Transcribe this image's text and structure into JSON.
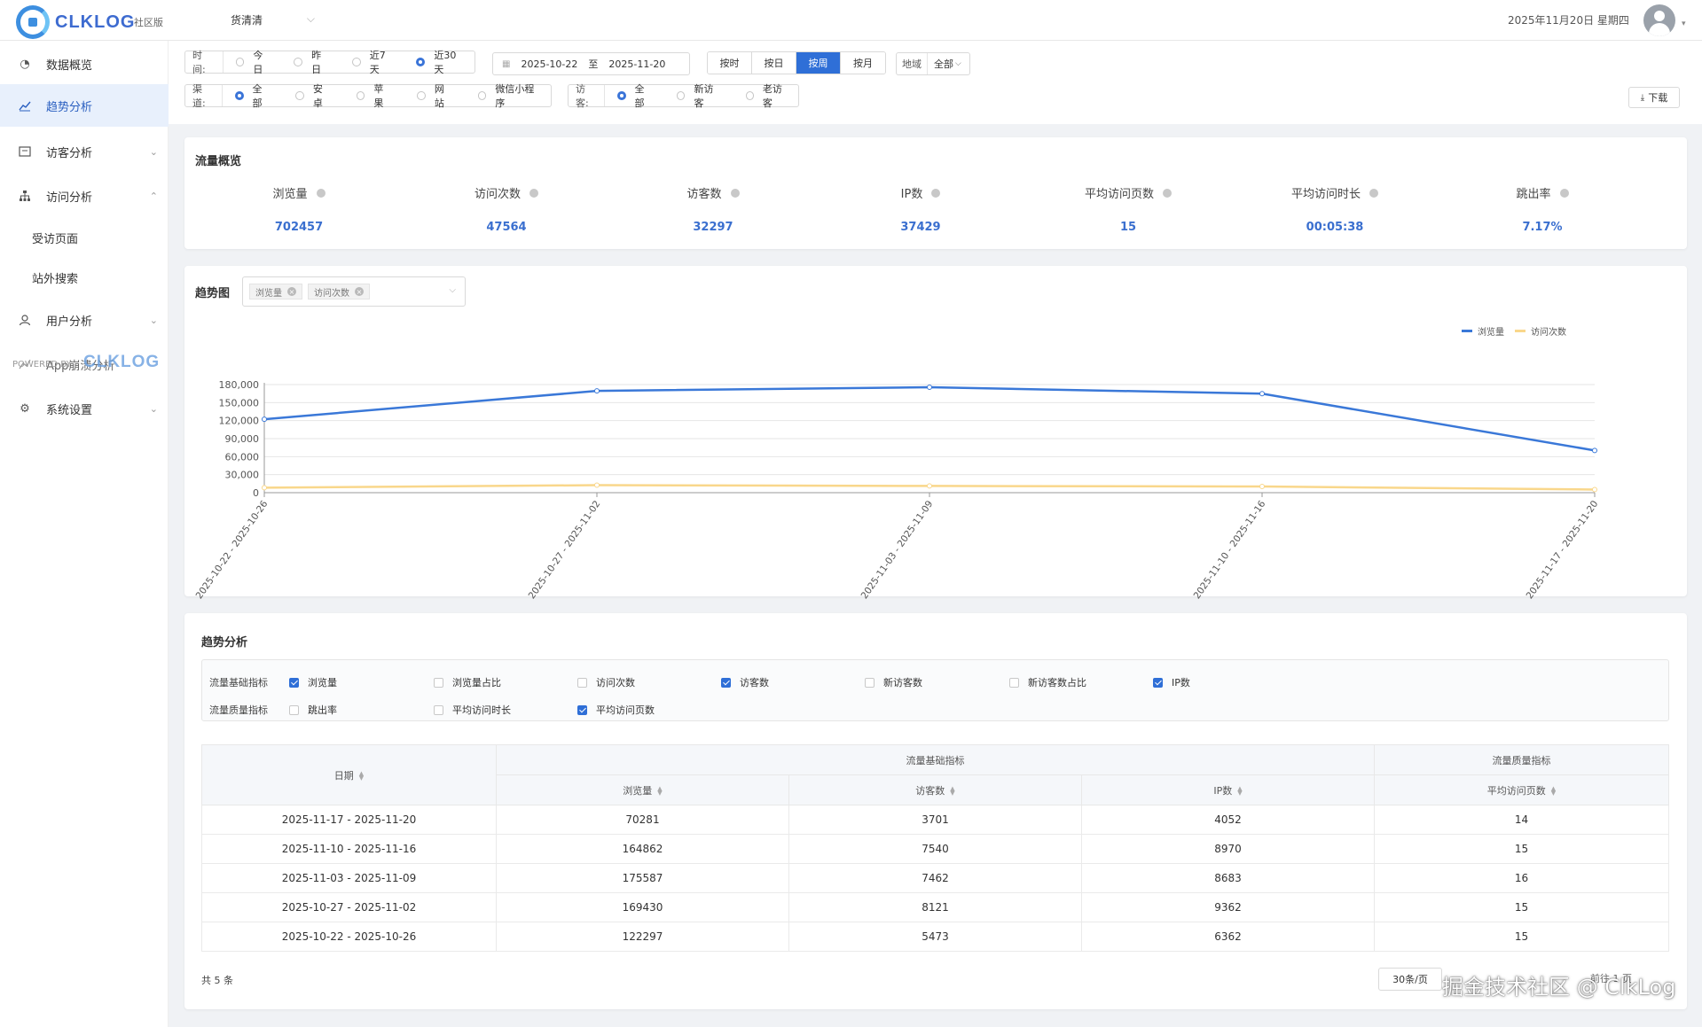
{
  "header": {
    "logo_text": "CLKLOG",
    "edition": "社区版",
    "product_select": "货清清",
    "date_now": "2025年11月20日 星期四"
  },
  "sidebar": {
    "items": [
      {
        "label": "数据概览",
        "icon": "dashboard-icon"
      },
      {
        "label": "趋势分析",
        "icon": "chart-line-icon"
      },
      {
        "label": "访客分析",
        "icon": "visitor-icon"
      },
      {
        "label": "访问分析",
        "icon": "sitemap-icon"
      },
      {
        "label": "用户分析",
        "icon": "user-icon"
      },
      {
        "label": "App崩溃分析",
        "icon": "crash-icon"
      },
      {
        "label": "系统设置",
        "icon": "gear-icon"
      }
    ],
    "sub_items": [
      "受访页面",
      "站外搜索"
    ],
    "powered_by": "POWERED BY",
    "powered_logo": "CLKLOG"
  },
  "filters": {
    "time_label": "时间:",
    "time_options": [
      "今日",
      "昨日",
      "近7天",
      "近30天"
    ],
    "date_from": "2025-10-22",
    "date_sep": "至",
    "date_to": "2025-11-20",
    "granularity": [
      "按时",
      "按日",
      "按周",
      "按月"
    ],
    "region_label": "地域",
    "region_value": "全部",
    "channel_label": "渠道:",
    "channel_options": [
      "全部",
      "安卓",
      "苹果",
      "网站",
      "微信小程序"
    ],
    "visitor_label": "访客:",
    "visitor_options": [
      "全部",
      "新访客",
      "老访客"
    ],
    "download_label": "下载"
  },
  "overview": {
    "title": "流量概览",
    "metrics": [
      {
        "name": "浏览量",
        "value": "702457"
      },
      {
        "name": "访问次数",
        "value": "47564"
      },
      {
        "name": "访客数",
        "value": "32297"
      },
      {
        "name": "IP数",
        "value": "37429"
      },
      {
        "name": "平均访问页数",
        "value": "15"
      },
      {
        "name": "平均访问时长",
        "value": "00:05:38"
      },
      {
        "name": "跳出率",
        "value": "7.17%"
      }
    ]
  },
  "trend": {
    "title": "趋势图",
    "tags": [
      "浏览量",
      "访问次数"
    ]
  },
  "chart_data": {
    "type": "line",
    "categories": [
      "2025-10-22 - 2025-10-26",
      "2025-10-27 - 2025-11-02",
      "2025-11-03 - 2025-11-09",
      "2025-11-10 - 2025-11-16",
      "2025-11-17 - 2025-11-20"
    ],
    "series": [
      {
        "name": "浏览量",
        "color": "#3a78d8",
        "values": [
          122297,
          169430,
          175587,
          164862,
          70281
        ]
      },
      {
        "name": "访问次数",
        "color": "#f9d78b",
        "values": [
          8300,
          12500,
          11200,
          10300,
          5200
        ]
      }
    ],
    "yticks": [
      "0",
      "30,000",
      "60,000",
      "90,000",
      "120,000",
      "150,000",
      "180,000"
    ],
    "ylim": [
      0,
      180000
    ]
  },
  "analysis": {
    "title": "趋势分析",
    "row1_label": "流量基础指标",
    "row2_label": "流量质量指标",
    "row1": [
      {
        "label": "浏览量",
        "checked": true
      },
      {
        "label": "浏览量占比",
        "checked": false
      },
      {
        "label": "访问次数",
        "checked": false
      },
      {
        "label": "访客数",
        "checked": true
      },
      {
        "label": "新访客数",
        "checked": false
      },
      {
        "label": "新访客数占比",
        "checked": false
      },
      {
        "label": "IP数",
        "checked": true
      }
    ],
    "row2": [
      {
        "label": "跳出率",
        "checked": false
      },
      {
        "label": "平均访问时长",
        "checked": false
      },
      {
        "label": "平均访问页数",
        "checked": true
      }
    ]
  },
  "table": {
    "date_header": "日期",
    "group1": "流量基础指标",
    "group2": "流量质量指标",
    "columns": [
      "浏览量",
      "访客数",
      "IP数",
      "平均访问页数"
    ],
    "rows": [
      [
        "2025-11-17 - 2025-11-20",
        "70281",
        "3701",
        "4052",
        "14"
      ],
      [
        "2025-11-10 - 2025-11-16",
        "164862",
        "7540",
        "8970",
        "15"
      ],
      [
        "2025-11-03 - 2025-11-09",
        "175587",
        "7462",
        "8683",
        "16"
      ],
      [
        "2025-10-27 - 2025-11-02",
        "169430",
        "8121",
        "9362",
        "15"
      ],
      [
        "2025-10-22 - 2025-10-26",
        "122297",
        "5473",
        "6362",
        "15"
      ]
    ]
  },
  "pager": {
    "total": "共 5 条",
    "page_size": "30条/页",
    "goto": "前往",
    "page": "1",
    "page_unit": "页"
  },
  "watermark": "掘金技术社区 @ ClkLog"
}
